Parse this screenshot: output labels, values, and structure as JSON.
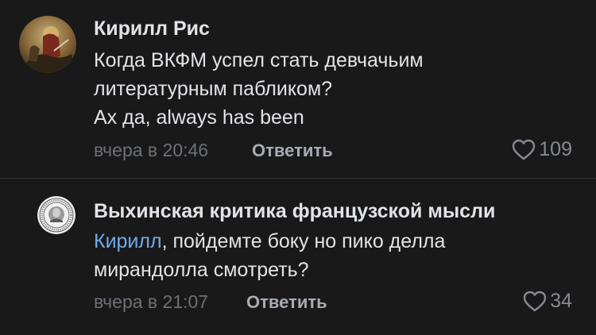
{
  "comments": [
    {
      "author": "Кирилл Рис",
      "avatar_icon": "painting-avatar",
      "lines": [
        "Когда ВКФМ успел стать девчачьим",
        "литературным пабликом?",
        "Ах да, always has been"
      ],
      "timestamp": "вчера в 20:46",
      "reply_label": "Ответить",
      "likes": "109",
      "like_icon": "heart-outline-icon"
    },
    {
      "author": "Выхинская критика французской мысли",
      "avatar_icon": "round-seal-avatar",
      "mention": "Кирилл",
      "text_after_mention": ", пойдемте боку но пико делла",
      "line2": "мирандолла смотреть?",
      "timestamp": "вчера в 21:07",
      "reply_label": "Ответить",
      "likes": "34",
      "like_icon": "heart-outline-icon"
    }
  ],
  "colors": {
    "background": "#19191a",
    "text": "#e1e3e6",
    "secondary": "#6d7075",
    "mention": "#71aaeb",
    "divider": "#313133"
  }
}
